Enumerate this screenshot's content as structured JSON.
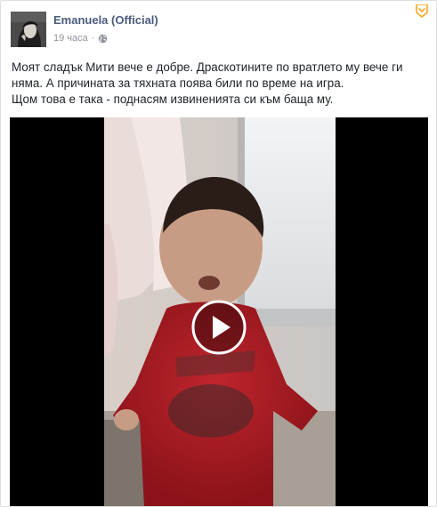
{
  "post": {
    "author": "Emanuela (Official)",
    "timestamp": "19 часа",
    "separator": "·",
    "privacy_icon": "globe-icon",
    "options_icon": "chevron-down-icon",
    "text_lines": [
      "Моят сладък Мити вече е добре. Драскотините по вратлето му вече ги",
      "няма. А причината за тяхната поява били по време на игра.",
      "Щом това е така - поднасям извиненията си към баща му."
    ],
    "video": {
      "play_icon": "play-icon"
    }
  },
  "colors": {
    "author": "#4b5b7e",
    "meta": "#90949c",
    "text": "#1d2129",
    "options_chevron": "#f5a623",
    "video_bg": "#000000"
  }
}
